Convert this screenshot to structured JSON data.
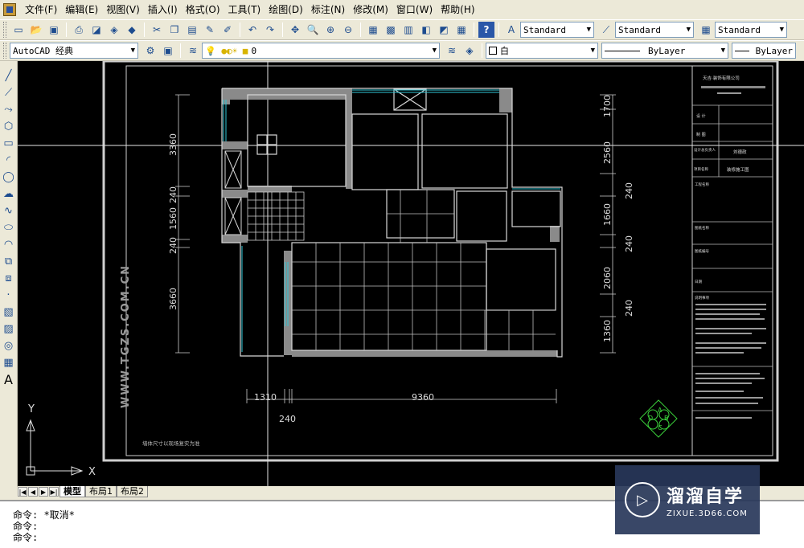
{
  "menu": [
    "文件(F)",
    "编辑(E)",
    "视图(V)",
    "插入(I)",
    "格式(O)",
    "工具(T)",
    "绘图(D)",
    "标注(N)",
    "修改(M)",
    "窗口(W)",
    "帮助(H)"
  ],
  "toolbar": {
    "text_style": "Standard",
    "dim_style": "Standard",
    "table_style": "Standard",
    "workspace": "AutoCAD 经典",
    "layer": "0",
    "color": "白",
    "linetype": "ByLayer",
    "lineweight": "ByLayer"
  },
  "left_tools": [
    "line-icon",
    "construction-line-icon",
    "polyline-icon",
    "polygon-icon",
    "rectangle-icon",
    "arc-icon",
    "circle-icon",
    "revision-cloud-icon",
    "spline-icon",
    "ellipse-icon",
    "ellipse-arc-icon",
    "insert-block-icon",
    "make-block-icon",
    "point-icon",
    "hatch-icon",
    "gradient-icon",
    "region-icon",
    "table-icon"
  ],
  "left_text_tool": "A",
  "drawing": {
    "dims_left": [
      "3360",
      "240",
      "1560",
      "240",
      "3660"
    ],
    "dims_right": [
      "1700",
      "2560",
      "240",
      "1660",
      "240",
      "2060",
      "240",
      "1360"
    ],
    "dims_bottom": [
      "1310",
      "9360",
      "240"
    ],
    "watermark_vertical": "WWW.TGZS.COM.CN",
    "note": "墙体尺寸以现场复实为准",
    "title_block": {
      "company": "天吉·装饰有限公司",
      "rows": [
        "设 计",
        "制 图",
        "设计总负责人",
        "项目名称",
        "工程名称",
        "图纸名称",
        "图纸编号",
        "日期"
      ],
      "designer": "刘德政",
      "project": "装修施工图",
      "notes_title": "说明事项"
    },
    "ucs_x": "X",
    "ucs_y": "Y",
    "compass_letters": [
      "A",
      "B",
      "C",
      "D"
    ]
  },
  "tabs": [
    "模型",
    "布局1",
    "布局2"
  ],
  "command_lines": [
    "命令: *取消*",
    "命令:",
    "命令:"
  ],
  "watermark": {
    "title": "溜溜自学",
    "url": "ZIXUE.3D66.COM"
  }
}
